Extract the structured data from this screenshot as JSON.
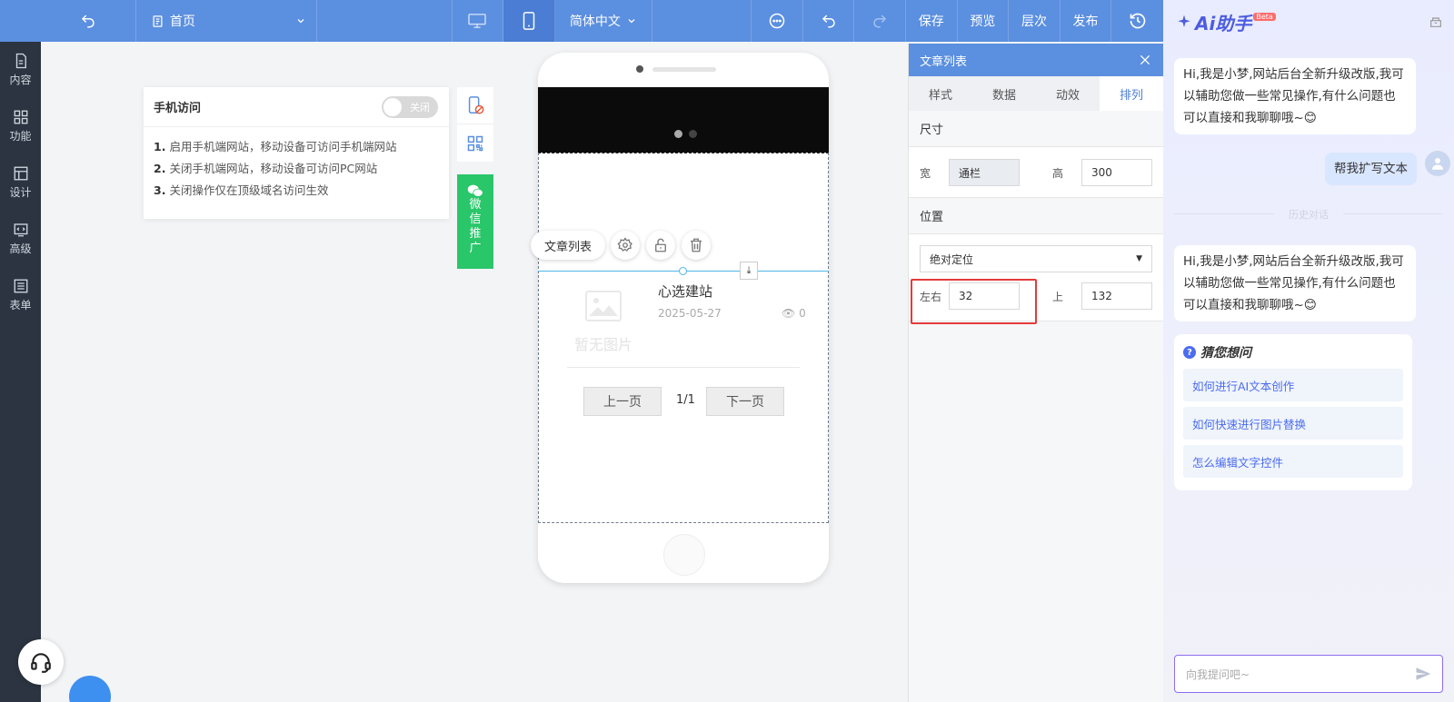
{
  "topbar": {
    "page_label": "首页",
    "language": "简体中文",
    "save": "保存",
    "preview": "预览",
    "layers": "层次",
    "publish": "发布"
  },
  "sidebar": {
    "items": [
      {
        "label": "内容",
        "icon": "document-icon"
      },
      {
        "label": "功能",
        "icon": "grid-icon"
      },
      {
        "label": "设计",
        "icon": "layout-icon"
      },
      {
        "label": "高级",
        "icon": "code-icon"
      },
      {
        "label": "表单",
        "icon": "form-icon"
      }
    ]
  },
  "mobile_access": {
    "title": "手机访问",
    "toggle_label": "关闭",
    "toggle_on": false,
    "items": [
      {
        "num": "1.",
        "text": "启用手机端网站，移动设备可访问手机端网站"
      },
      {
        "num": "2.",
        "text": "关闭手机端网站，移动设备可访问PC网站"
      },
      {
        "num": "3.",
        "text": "关闭操作仅在顶级域名访问生效"
      }
    ],
    "wechat_chars": [
      "微",
      "信",
      "推",
      "广"
    ]
  },
  "element_toolbar": {
    "label": "文章列表"
  },
  "phone_preview": {
    "article": {
      "no_image": "暂无图片",
      "title": "心选建站",
      "date": "2025-05-27",
      "views": "0"
    },
    "pagination": {
      "prev": "上一页",
      "current": "1/1",
      "next": "下一页"
    }
  },
  "panel": {
    "title": "文章列表",
    "tabs": [
      "样式",
      "数据",
      "动效",
      "排列"
    ],
    "active_tab": "排列",
    "size": {
      "title": "尺寸",
      "width_label": "宽",
      "width_value": "通栏",
      "height_label": "高",
      "height_value": "300"
    },
    "position": {
      "title": "位置",
      "mode": "绝对定位",
      "left_label": "左右",
      "left_value": "32",
      "top_label": "上",
      "top_value": "132"
    }
  },
  "ai": {
    "brand": "Ai助手",
    "beta": "Beta",
    "greeting": "Hi,我是小梦,网站后台全新升级改版,我可以辅助您做一些常见操作,有什么问题也可以直接和我聊聊哦~😊",
    "user_msg": "帮我扩写文本",
    "history_label": "历史对话",
    "guess_title": "猜您想问",
    "suggestions": [
      "如何进行AI文本创作",
      "如何快速进行图片替换",
      "怎么编辑文字控件"
    ],
    "input_placeholder": "向我提问吧~"
  },
  "colors": {
    "topbar": "#5b8fe0",
    "sidebar": "#2b3440",
    "wechat": "#2ac66a",
    "highlight": "#e53a3a",
    "accent": "#4a6cf0"
  }
}
